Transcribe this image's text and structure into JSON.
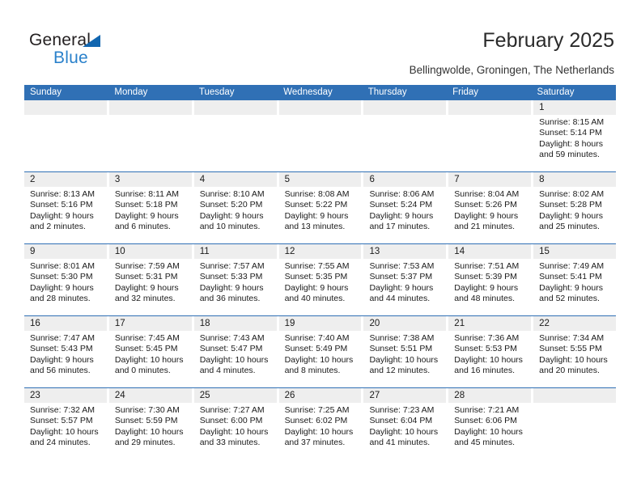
{
  "brand": {
    "name_part1": "General",
    "name_part2": "Blue",
    "accent_color": "#2a81cb",
    "triangle_color": "#1266b0"
  },
  "header": {
    "title": "February 2025",
    "subtitle": "Bellingwolde, Groningen, The Netherlands"
  },
  "calendar": {
    "header_bg": "#3070b5",
    "daynum_bg": "#eeeeee",
    "weekday_names": [
      "Sunday",
      "Monday",
      "Tuesday",
      "Wednesday",
      "Thursday",
      "Friday",
      "Saturday"
    ],
    "weeks": [
      [
        {
          "day": "",
          "sunrise": "",
          "sunset": "",
          "daylight_line1": "",
          "daylight_line2": ""
        },
        {
          "day": "",
          "sunrise": "",
          "sunset": "",
          "daylight_line1": "",
          "daylight_line2": ""
        },
        {
          "day": "",
          "sunrise": "",
          "sunset": "",
          "daylight_line1": "",
          "daylight_line2": ""
        },
        {
          "day": "",
          "sunrise": "",
          "sunset": "",
          "daylight_line1": "",
          "daylight_line2": ""
        },
        {
          "day": "",
          "sunrise": "",
          "sunset": "",
          "daylight_line1": "",
          "daylight_line2": ""
        },
        {
          "day": "",
          "sunrise": "",
          "sunset": "",
          "daylight_line1": "",
          "daylight_line2": ""
        },
        {
          "day": "1",
          "sunrise": "Sunrise: 8:15 AM",
          "sunset": "Sunset: 5:14 PM",
          "daylight_line1": "Daylight: 8 hours",
          "daylight_line2": "and 59 minutes."
        }
      ],
      [
        {
          "day": "2",
          "sunrise": "Sunrise: 8:13 AM",
          "sunset": "Sunset: 5:16 PM",
          "daylight_line1": "Daylight: 9 hours",
          "daylight_line2": "and 2 minutes."
        },
        {
          "day": "3",
          "sunrise": "Sunrise: 8:11 AM",
          "sunset": "Sunset: 5:18 PM",
          "daylight_line1": "Daylight: 9 hours",
          "daylight_line2": "and 6 minutes."
        },
        {
          "day": "4",
          "sunrise": "Sunrise: 8:10 AM",
          "sunset": "Sunset: 5:20 PM",
          "daylight_line1": "Daylight: 9 hours",
          "daylight_line2": "and 10 minutes."
        },
        {
          "day": "5",
          "sunrise": "Sunrise: 8:08 AM",
          "sunset": "Sunset: 5:22 PM",
          "daylight_line1": "Daylight: 9 hours",
          "daylight_line2": "and 13 minutes."
        },
        {
          "day": "6",
          "sunrise": "Sunrise: 8:06 AM",
          "sunset": "Sunset: 5:24 PM",
          "daylight_line1": "Daylight: 9 hours",
          "daylight_line2": "and 17 minutes."
        },
        {
          "day": "7",
          "sunrise": "Sunrise: 8:04 AM",
          "sunset": "Sunset: 5:26 PM",
          "daylight_line1": "Daylight: 9 hours",
          "daylight_line2": "and 21 minutes."
        },
        {
          "day": "8",
          "sunrise": "Sunrise: 8:02 AM",
          "sunset": "Sunset: 5:28 PM",
          "daylight_line1": "Daylight: 9 hours",
          "daylight_line2": "and 25 minutes."
        }
      ],
      [
        {
          "day": "9",
          "sunrise": "Sunrise: 8:01 AM",
          "sunset": "Sunset: 5:30 PM",
          "daylight_line1": "Daylight: 9 hours",
          "daylight_line2": "and 28 minutes."
        },
        {
          "day": "10",
          "sunrise": "Sunrise: 7:59 AM",
          "sunset": "Sunset: 5:31 PM",
          "daylight_line1": "Daylight: 9 hours",
          "daylight_line2": "and 32 minutes."
        },
        {
          "day": "11",
          "sunrise": "Sunrise: 7:57 AM",
          "sunset": "Sunset: 5:33 PM",
          "daylight_line1": "Daylight: 9 hours",
          "daylight_line2": "and 36 minutes."
        },
        {
          "day": "12",
          "sunrise": "Sunrise: 7:55 AM",
          "sunset": "Sunset: 5:35 PM",
          "daylight_line1": "Daylight: 9 hours",
          "daylight_line2": "and 40 minutes."
        },
        {
          "day": "13",
          "sunrise": "Sunrise: 7:53 AM",
          "sunset": "Sunset: 5:37 PM",
          "daylight_line1": "Daylight: 9 hours",
          "daylight_line2": "and 44 minutes."
        },
        {
          "day": "14",
          "sunrise": "Sunrise: 7:51 AM",
          "sunset": "Sunset: 5:39 PM",
          "daylight_line1": "Daylight: 9 hours",
          "daylight_line2": "and 48 minutes."
        },
        {
          "day": "15",
          "sunrise": "Sunrise: 7:49 AM",
          "sunset": "Sunset: 5:41 PM",
          "daylight_line1": "Daylight: 9 hours",
          "daylight_line2": "and 52 minutes."
        }
      ],
      [
        {
          "day": "16",
          "sunrise": "Sunrise: 7:47 AM",
          "sunset": "Sunset: 5:43 PM",
          "daylight_line1": "Daylight: 9 hours",
          "daylight_line2": "and 56 minutes."
        },
        {
          "day": "17",
          "sunrise": "Sunrise: 7:45 AM",
          "sunset": "Sunset: 5:45 PM",
          "daylight_line1": "Daylight: 10 hours",
          "daylight_line2": "and 0 minutes."
        },
        {
          "day": "18",
          "sunrise": "Sunrise: 7:43 AM",
          "sunset": "Sunset: 5:47 PM",
          "daylight_line1": "Daylight: 10 hours",
          "daylight_line2": "and 4 minutes."
        },
        {
          "day": "19",
          "sunrise": "Sunrise: 7:40 AM",
          "sunset": "Sunset: 5:49 PM",
          "daylight_line1": "Daylight: 10 hours",
          "daylight_line2": "and 8 minutes."
        },
        {
          "day": "20",
          "sunrise": "Sunrise: 7:38 AM",
          "sunset": "Sunset: 5:51 PM",
          "daylight_line1": "Daylight: 10 hours",
          "daylight_line2": "and 12 minutes."
        },
        {
          "day": "21",
          "sunrise": "Sunrise: 7:36 AM",
          "sunset": "Sunset: 5:53 PM",
          "daylight_line1": "Daylight: 10 hours",
          "daylight_line2": "and 16 minutes."
        },
        {
          "day": "22",
          "sunrise": "Sunrise: 7:34 AM",
          "sunset": "Sunset: 5:55 PM",
          "daylight_line1": "Daylight: 10 hours",
          "daylight_line2": "and 20 minutes."
        }
      ],
      [
        {
          "day": "23",
          "sunrise": "Sunrise: 7:32 AM",
          "sunset": "Sunset: 5:57 PM",
          "daylight_line1": "Daylight: 10 hours",
          "daylight_line2": "and 24 minutes."
        },
        {
          "day": "24",
          "sunrise": "Sunrise: 7:30 AM",
          "sunset": "Sunset: 5:59 PM",
          "daylight_line1": "Daylight: 10 hours",
          "daylight_line2": "and 29 minutes."
        },
        {
          "day": "25",
          "sunrise": "Sunrise: 7:27 AM",
          "sunset": "Sunset: 6:00 PM",
          "daylight_line1": "Daylight: 10 hours",
          "daylight_line2": "and 33 minutes."
        },
        {
          "day": "26",
          "sunrise": "Sunrise: 7:25 AM",
          "sunset": "Sunset: 6:02 PM",
          "daylight_line1": "Daylight: 10 hours",
          "daylight_line2": "and 37 minutes."
        },
        {
          "day": "27",
          "sunrise": "Sunrise: 7:23 AM",
          "sunset": "Sunset: 6:04 PM",
          "daylight_line1": "Daylight: 10 hours",
          "daylight_line2": "and 41 minutes."
        },
        {
          "day": "28",
          "sunrise": "Sunrise: 7:21 AM",
          "sunset": "Sunset: 6:06 PM",
          "daylight_line1": "Daylight: 10 hours",
          "daylight_line2": "and 45 minutes."
        },
        {
          "day": "",
          "sunrise": "",
          "sunset": "",
          "daylight_line1": "",
          "daylight_line2": ""
        }
      ]
    ]
  }
}
